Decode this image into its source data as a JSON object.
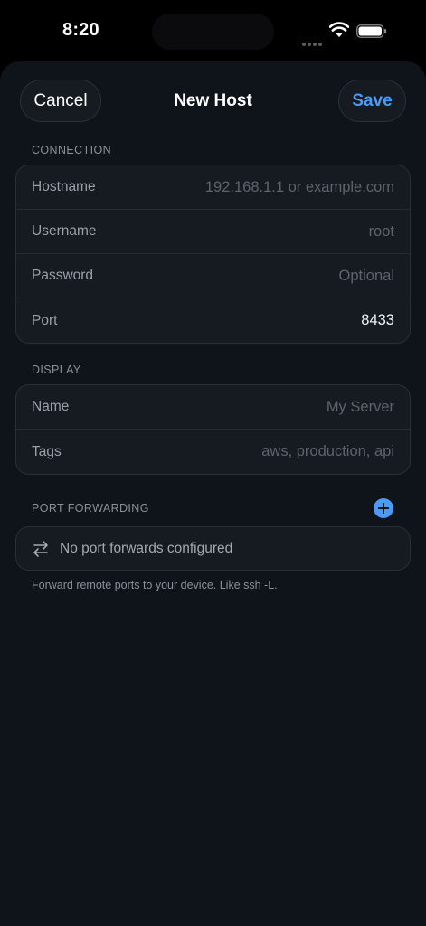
{
  "status_bar": {
    "time": "8:20"
  },
  "nav": {
    "cancel_label": "Cancel",
    "title": "New Host",
    "save_label": "Save"
  },
  "connection": {
    "header": "CONNECTION",
    "rows": [
      {
        "label": "Hostname",
        "placeholder": "192.168.1.1 or example.com",
        "value": ""
      },
      {
        "label": "Username",
        "placeholder": "root",
        "value": ""
      },
      {
        "label": "Password",
        "placeholder": "Optional",
        "value": ""
      },
      {
        "label": "Port",
        "placeholder": "",
        "value": "8433"
      }
    ]
  },
  "display": {
    "header": "DISPLAY",
    "rows": [
      {
        "label": "Name",
        "placeholder": "My Server",
        "value": ""
      },
      {
        "label": "Tags",
        "placeholder": "aws, production, api",
        "value": ""
      }
    ]
  },
  "port_forwarding": {
    "header": "PORT FORWARDING",
    "empty_text": "No port forwards configured",
    "footnote": "Forward remote ports to your device. Like ssh -L."
  },
  "colors": {
    "accent": "#4a9bf5",
    "background": "#0f131a",
    "card": "#161a21"
  },
  "icons": [
    "wifi-icon",
    "battery-icon",
    "cellular-signal-icon",
    "add-icon",
    "swap-arrows-icon"
  ]
}
